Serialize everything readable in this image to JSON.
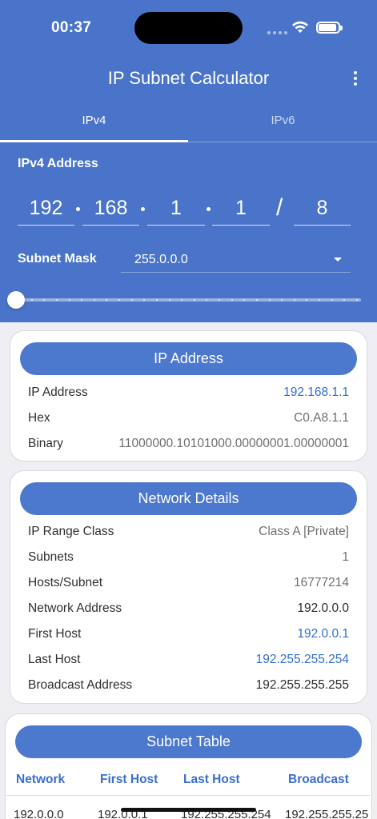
{
  "status_bar": {
    "time": "00:37"
  },
  "app": {
    "title": "IP Subnet Calculator"
  },
  "tabs": [
    {
      "label": "IPv4"
    },
    {
      "label": "IPv6"
    }
  ],
  "ipv4": {
    "address_label": "IPv4 Address",
    "octets": [
      "192",
      "168",
      "1",
      "1"
    ],
    "separator": "/",
    "cidr": "8",
    "mask_label": "Subnet Mask",
    "mask_value": "255.0.0.0",
    "slider_value": 8
  },
  "ip_card": {
    "title": "IP Address",
    "rows": [
      {
        "key": "IP Address",
        "value": "192.168.1.1"
      },
      {
        "key": "Hex",
        "value": "C0.A8.1.1"
      },
      {
        "key": "Binary",
        "value": "11000000.10101000.00000001.00000001"
      }
    ]
  },
  "network_card": {
    "title": "Network Details",
    "rows": [
      {
        "key": "IP Range Class",
        "value": "Class A [Private]"
      },
      {
        "key": "Subnets",
        "value": "1"
      },
      {
        "key": "Hosts/Subnet",
        "value": "16777214"
      },
      {
        "key": "Network Address",
        "value": "192.0.0.0"
      },
      {
        "key": "First Host",
        "value": "192.0.0.1"
      },
      {
        "key": "Last Host",
        "value": "192.255.255.254"
      },
      {
        "key": "Broadcast Address",
        "value": "192.255.255.255"
      }
    ]
  },
  "subnet_table": {
    "title": "Subnet Table",
    "columns": [
      "Network",
      "First Host",
      "Last Host",
      "Broadcast"
    ],
    "rows": [
      [
        "192.0.0.0",
        "192.0.0.1",
        "192.255.255.254",
        "192.255.255.25"
      ]
    ]
  },
  "colors": {
    "primary": "#4a74c9",
    "link": "#2f6fcf",
    "header_accent": "#3b6fcc"
  }
}
